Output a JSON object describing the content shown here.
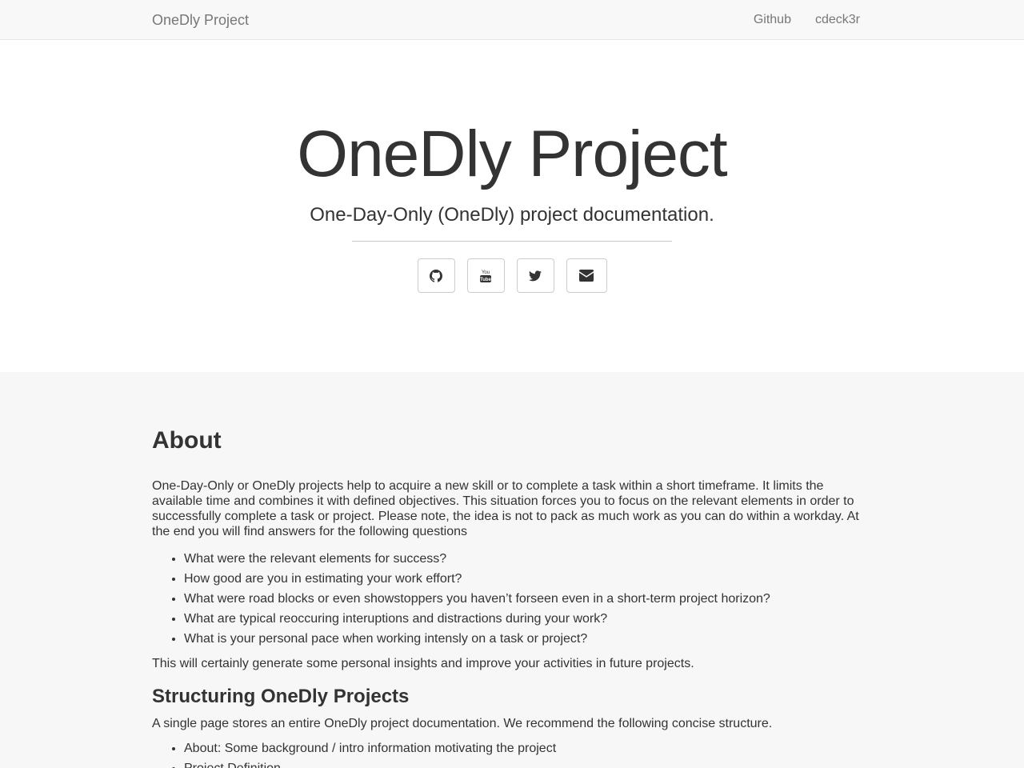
{
  "navbar": {
    "brand": "OneDly Project",
    "links": [
      "Github",
      "cdeck3r"
    ]
  },
  "hero": {
    "title": "OneDly Project",
    "subtitle": "One-Day-Only (OneDly) project documentation.",
    "social_icons": [
      "github-icon",
      "youtube-icon",
      "twitter-icon",
      "envelope-icon"
    ]
  },
  "about": {
    "title": "About",
    "paragraph": "One-Day-Only or OneDly projects help to acquire a new skill or to complete a task within a short timeframe. It limits the available time and combines it with defined objectives. This situation forces you to focus on the relevant elements in order to successfully complete a task or project. Please note, the idea is not to pack as much work as you can do within a workday. At the end you will find answers for the following questions",
    "questions": [
      "What were the relevant elements for success?",
      "How good are you in estimating your work effort?",
      "What were road blocks or even showstoppers you haven’t forseen even in a short-term project horizon?",
      "What are typical reoccuring interuptions and distractions during your work?",
      "What is your personal pace when working intensly on a task or project?"
    ],
    "closing": "This will certainly generate some personal insights and improve your activities in future projects."
  },
  "structuring": {
    "title": "Structuring OneDly Projects",
    "paragraph": "A single page stores an entire OneDly project documentation. We recommend the following concise structure.",
    "items": [
      "About: Some background / intro information motivating the project",
      "Project Definition"
    ]
  },
  "colors": {
    "navbar_bg": "#f8f8f8",
    "content_bg": "#f7f7f7",
    "text": "#333333",
    "nav_text": "#777777"
  }
}
